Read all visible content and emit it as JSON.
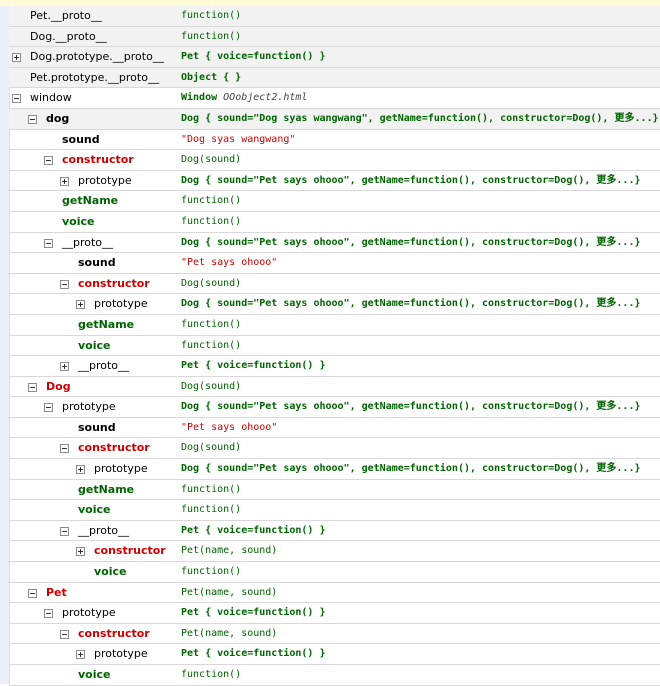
{
  "rows": [
    {
      "name": "Pet.__proto__",
      "indent": 0,
      "toggle": "",
      "style": "plain",
      "value": "function()",
      "vstyle": "fn",
      "hl": true
    },
    {
      "name": "Dog.__proto__",
      "indent": 0,
      "toggle": "",
      "style": "plain",
      "value": "function()",
      "vstyle": "fn",
      "hl": true
    },
    {
      "name": "Dog.prototype.__proto__",
      "indent": 0,
      "toggle": "plus",
      "style": "plain",
      "value": "Pet { voice=function() }",
      "vstyle": "obj",
      "hl": true
    },
    {
      "name": "Pet.prototype.__proto__",
      "indent": 0,
      "toggle": "",
      "style": "plain",
      "value": "Object { }",
      "vstyle": "obj",
      "hl": true
    },
    {
      "name": "window",
      "indent": 0,
      "toggle": "minus",
      "style": "plain",
      "value": "Window",
      "value2": "OOobject2.html",
      "vstyle": "win",
      "hl": false
    },
    {
      "name": "dog",
      "indent": 1,
      "toggle": "minus",
      "style": "bold",
      "value": "Dog { sound=\"Dog syas wangwang\", getName=function(), constructor=Dog(), 更多...}",
      "vstyle": "obj",
      "hl": true
    },
    {
      "name": "sound",
      "indent": 2,
      "toggle": "",
      "style": "bold",
      "value": "\"Dog syas wangwang\"",
      "vstyle": "str",
      "hl": false
    },
    {
      "name": "constructor",
      "indent": 2,
      "toggle": "minus",
      "style": "red",
      "value": "Dog(sound)",
      "vstyle": "fn",
      "hl": false
    },
    {
      "name": "prototype",
      "indent": 3,
      "toggle": "plus",
      "style": "plain",
      "value": "Dog { sound=\"Pet says ohooo\", getName=function(), constructor=Dog(), 更多...}",
      "vstyle": "obj",
      "hl": false
    },
    {
      "name": "getName",
      "indent": 2,
      "toggle": "",
      "style": "green",
      "value": "function()",
      "vstyle": "fn",
      "hl": false
    },
    {
      "name": "voice",
      "indent": 2,
      "toggle": "",
      "style": "green",
      "value": "function()",
      "vstyle": "fn",
      "hl": false
    },
    {
      "name": "__proto__",
      "indent": 2,
      "toggle": "minus",
      "style": "plain",
      "value": "Dog { sound=\"Pet says ohooo\", getName=function(), constructor=Dog(), 更多...}",
      "vstyle": "obj",
      "hl": false
    },
    {
      "name": "sound",
      "indent": 3,
      "toggle": "",
      "style": "bold",
      "value": "\"Pet says ohooo\"",
      "vstyle": "str",
      "hl": false
    },
    {
      "name": "constructor",
      "indent": 3,
      "toggle": "minus",
      "style": "red",
      "value": "Dog(sound)",
      "vstyle": "fn",
      "hl": false
    },
    {
      "name": "prototype",
      "indent": 4,
      "toggle": "plus",
      "style": "plain",
      "value": "Dog { sound=\"Pet says ohooo\", getName=function(), constructor=Dog(), 更多...}",
      "vstyle": "obj",
      "hl": false
    },
    {
      "name": "getName",
      "indent": 3,
      "toggle": "",
      "style": "green",
      "value": "function()",
      "vstyle": "fn",
      "hl": false
    },
    {
      "name": "voice",
      "indent": 3,
      "toggle": "",
      "style": "green",
      "value": "function()",
      "vstyle": "fn",
      "hl": false
    },
    {
      "name": "__proto__",
      "indent": 3,
      "toggle": "plus",
      "style": "plain",
      "value": "Pet { voice=function() }",
      "vstyle": "obj",
      "hl": false
    },
    {
      "name": "Dog",
      "indent": 1,
      "toggle": "minus",
      "style": "red",
      "value": "Dog(sound)",
      "vstyle": "fn",
      "hl": false
    },
    {
      "name": "prototype",
      "indent": 2,
      "toggle": "minus",
      "style": "plain",
      "value": "Dog { sound=\"Pet says ohooo\", getName=function(), constructor=Dog(), 更多...}",
      "vstyle": "obj",
      "hl": false
    },
    {
      "name": "sound",
      "indent": 3,
      "toggle": "",
      "style": "bold",
      "value": "\"Pet says ohooo\"",
      "vstyle": "str",
      "hl": false
    },
    {
      "name": "constructor",
      "indent": 3,
      "toggle": "minus",
      "style": "red",
      "value": "Dog(sound)",
      "vstyle": "fn",
      "hl": false
    },
    {
      "name": "prototype",
      "indent": 4,
      "toggle": "plus",
      "style": "plain",
      "value": "Dog { sound=\"Pet says ohooo\", getName=function(), constructor=Dog(), 更多...}",
      "vstyle": "obj",
      "hl": false
    },
    {
      "name": "getName",
      "indent": 3,
      "toggle": "",
      "style": "green",
      "value": "function()",
      "vstyle": "fn",
      "hl": false
    },
    {
      "name": "voice",
      "indent": 3,
      "toggle": "",
      "style": "green",
      "value": "function()",
      "vstyle": "fn",
      "hl": false
    },
    {
      "name": "__proto__",
      "indent": 3,
      "toggle": "minus",
      "style": "plain",
      "value": "Pet { voice=function() }",
      "vstyle": "obj",
      "hl": false
    },
    {
      "name": "constructor",
      "indent": 4,
      "toggle": "plus",
      "style": "red",
      "value": "Pet(name, sound)",
      "vstyle": "fn",
      "hl": false
    },
    {
      "name": "voice",
      "indent": 4,
      "toggle": "",
      "style": "green",
      "value": "function()",
      "vstyle": "fn",
      "hl": false
    },
    {
      "name": "Pet",
      "indent": 1,
      "toggle": "minus",
      "style": "red",
      "value": "Pet(name, sound)",
      "vstyle": "fn",
      "hl": false
    },
    {
      "name": "prototype",
      "indent": 2,
      "toggle": "minus",
      "style": "plain",
      "value": "Pet { voice=function() }",
      "vstyle": "obj",
      "hl": false
    },
    {
      "name": "constructor",
      "indent": 3,
      "toggle": "minus",
      "style": "red",
      "value": "Pet(name, sound)",
      "vstyle": "fn",
      "hl": false
    },
    {
      "name": "prototype",
      "indent": 4,
      "toggle": "plus",
      "style": "plain",
      "value": "Pet { voice=function() }",
      "vstyle": "obj",
      "hl": false
    },
    {
      "name": "voice",
      "indent": 3,
      "toggle": "",
      "style": "green",
      "value": "function()",
      "vstyle": "fn",
      "hl": false
    }
  ]
}
